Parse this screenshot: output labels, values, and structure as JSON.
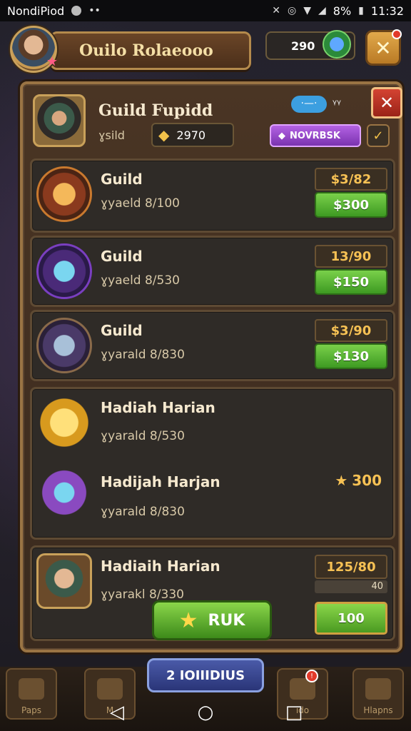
{
  "status_bar": {
    "carrier": "NondiPiod",
    "battery": "8%",
    "time": "11:32"
  },
  "header": {
    "title": "Ouilo Rolaeooo",
    "currency": "290"
  },
  "guild": {
    "name": "Guild  Fupidd",
    "sub_label": "ɣsild",
    "coins": "2970",
    "chat_label": "·—·",
    "purple_button": "NOVRBSK"
  },
  "rows": [
    {
      "title": "Guild",
      "sub": "ɣyaeld 8/100",
      "price": "$3/82",
      "button": "$300",
      "color": "#c9792e"
    },
    {
      "title": "Guild",
      "sub": "ɣyaeld 8/530",
      "price": "13/90",
      "button": "$150",
      "color": "#7a3fc0"
    },
    {
      "title": "Guild",
      "sub": "ɣyarald 8/830",
      "price": "$3/90",
      "button": "$130",
      "color": "#5a4a7a"
    },
    {
      "title": "Hadiah Harian",
      "sub": "ɣyarald 8/530"
    },
    {
      "title": "Hadijah Harjan",
      "sub": "ɣyarald 8/830",
      "price": "300"
    },
    {
      "title": "Hadiaih Harian",
      "sub": "ɣyarakl 8/330",
      "price": "125/80",
      "price_sub": "40",
      "button": "100",
      "claim_button": "RUK"
    }
  ],
  "event_button": "2 IOIIIDIUS",
  "bottom_tabs": [
    {
      "label": "Paps"
    },
    {
      "label": "M"
    },
    {
      "label": "ido"
    },
    {
      "label": "Hlapns"
    }
  ]
}
